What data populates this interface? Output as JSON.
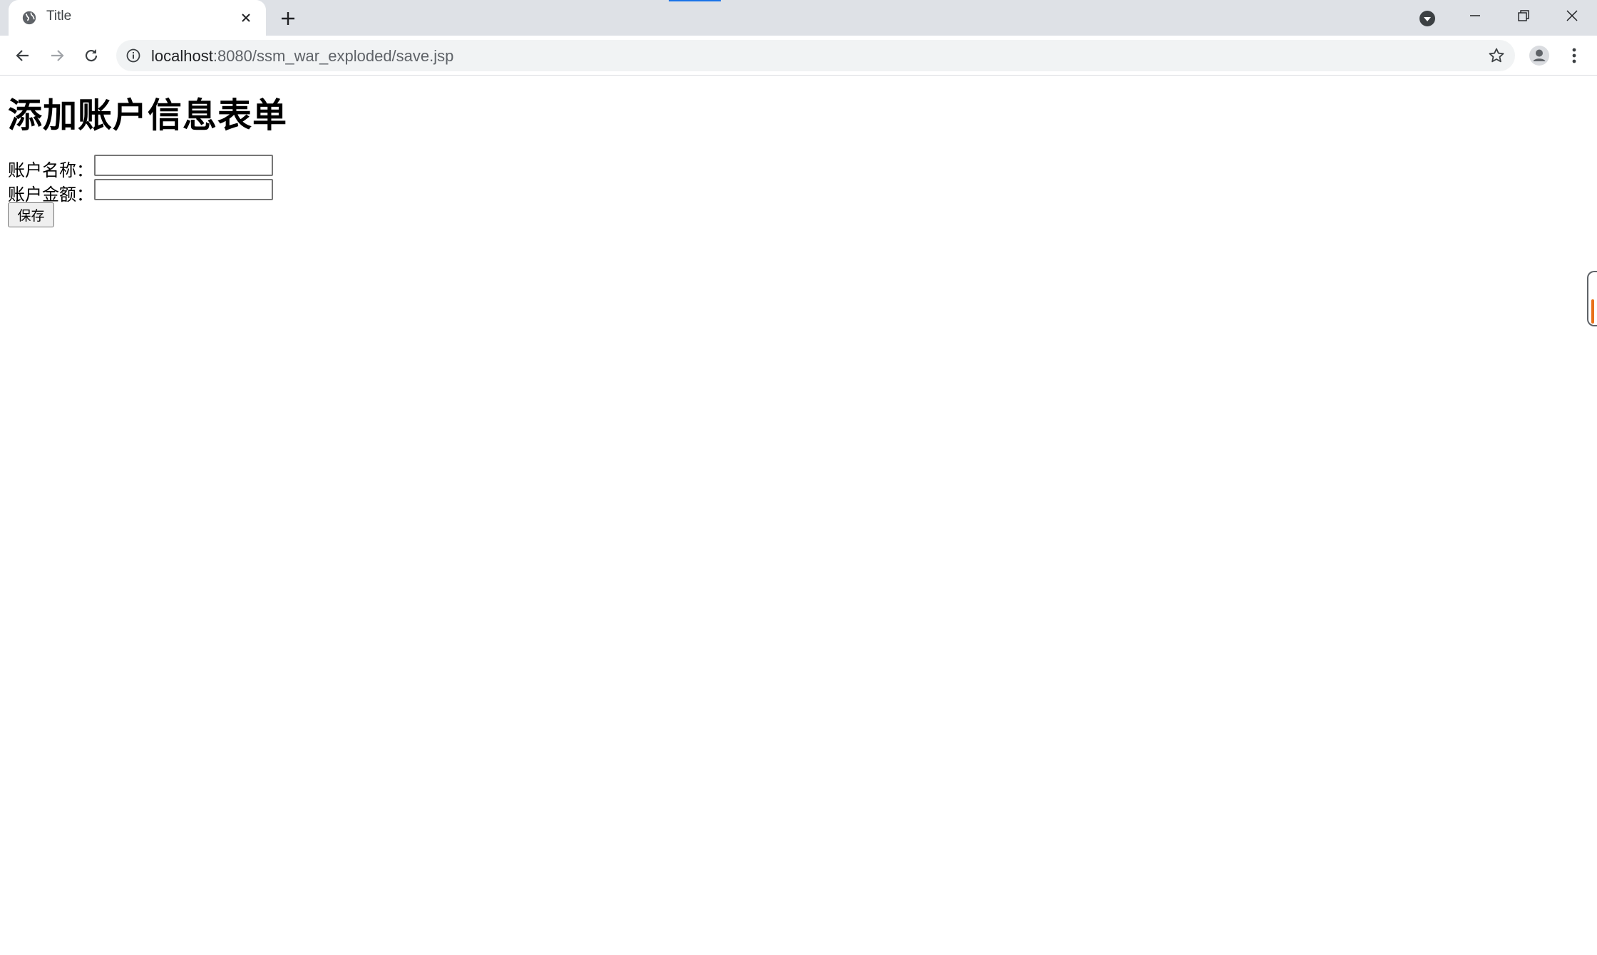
{
  "browser": {
    "tab": {
      "title": "Title",
      "favicon": "globe-icon",
      "close_icon": "close-icon"
    },
    "new_tab_icon": "plus-icon",
    "address_bar": {
      "host": "localhost",
      "path": ":8080/ssm_war_exploded/save.jsp",
      "info_icon": "info-icon",
      "bookmark_icon": "star-icon"
    },
    "toolbar_icons": [
      "back-arrow-icon",
      "forward-arrow-icon",
      "reload-icon",
      "avatar-icon",
      "kebab-menu-icon"
    ],
    "window_controls": [
      "minimize-icon",
      "restore-icon",
      "close-icon"
    ],
    "accent_color": "#1a73e8"
  },
  "page": {
    "heading": "添加账户信息表单",
    "form": {
      "name_label": "账户名称：",
      "name_value": "",
      "amount_label": "账户金额：",
      "amount_value": "",
      "submit_label": "保存"
    }
  }
}
